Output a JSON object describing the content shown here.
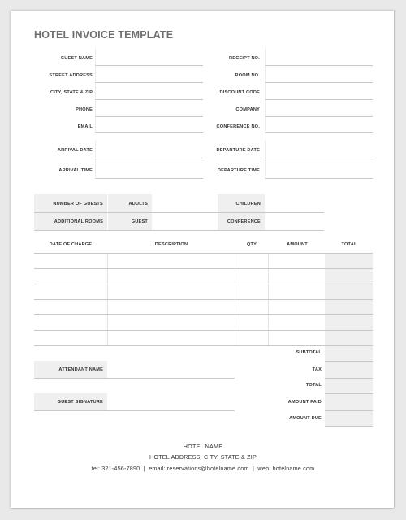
{
  "title": "HOTEL INVOICE TEMPLATE",
  "guest_info": {
    "left": [
      {
        "label": "GUEST NAME",
        "value": ""
      },
      {
        "label": "STREET ADDRESS",
        "value": ""
      },
      {
        "label": "CITY, STATE & ZIP",
        "value": ""
      },
      {
        "label": "PHONE",
        "value": ""
      },
      {
        "label": "EMAIL",
        "value": ""
      }
    ],
    "right": [
      {
        "label": "RECEIPT NO.",
        "value": ""
      },
      {
        "label": "ROOM NO.",
        "value": ""
      },
      {
        "label": "DISCOUNT CODE",
        "value": ""
      },
      {
        "label": "COMPANY",
        "value": ""
      },
      {
        "label": "CONFERENCE NO.",
        "value": ""
      }
    ]
  },
  "stay": {
    "arrival_date": "ARRIVAL DATE",
    "arrival_time": "ARRIVAL TIME",
    "departure_date": "DEPARTURE DATE",
    "departure_time": "DEPARTURE TIME"
  },
  "guests": {
    "number_of_guests": "NUMBER OF GUESTS",
    "adults": "ADULTS",
    "children": "CHILDREN",
    "additional_rooms": "ADDITIONAL ROOMS",
    "guest": "GUEST",
    "conference": "CONFERENCE"
  },
  "charges": {
    "columns": [
      "DATE OF CHARGE",
      "DESCRIPTION",
      "QTY",
      "AMOUNT",
      "TOTAL"
    ],
    "rows": [
      [
        "",
        "",
        "",
        "",
        ""
      ],
      [
        "",
        "",
        "",
        "",
        ""
      ],
      [
        "",
        "",
        "",
        "",
        ""
      ],
      [
        "",
        "",
        "",
        "",
        ""
      ],
      [
        "",
        "",
        "",
        "",
        ""
      ],
      [
        "",
        "",
        "",
        "",
        ""
      ]
    ]
  },
  "summary": [
    {
      "label": "SUBTOTAL",
      "value": ""
    },
    {
      "label": "TAX",
      "value": ""
    },
    {
      "label": "TOTAL",
      "value": ""
    },
    {
      "label": "AMOUNT PAID",
      "value": ""
    },
    {
      "label": "AMOUNT DUE",
      "value": ""
    }
  ],
  "signatures": {
    "attendant_name": "ATTENDANT NAME",
    "guest_signature": "GUEST SIGNATURE"
  },
  "footer": {
    "hotel_name": "HOTEL NAME",
    "address": "HOTEL ADDRESS, CITY, STATE & ZIP",
    "contact": "tel: 321-456-7890  |  email: reservations@hotelname.com  |  web: hotelname.com"
  }
}
